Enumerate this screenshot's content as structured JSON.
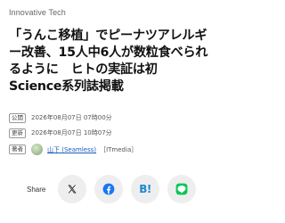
{
  "article": {
    "category": "Innovative Tech",
    "title": "「うんこ移植」でピーナツアレルギー改善、15人中6人が数粒食べられるように　ヒトの実証は初　Science系列誌掲載"
  },
  "meta": {
    "published_label": "公開",
    "published_value": "2026年08月07日 07時00分",
    "updated_label": "更新",
    "updated_value": "2026年08月07日 10時07分",
    "author_label": "著者",
    "author_name": "山下 (Seamless)",
    "author_org": "［ITmedia］"
  },
  "share": {
    "label": "Share",
    "buttons": [
      {
        "name": "x",
        "icon": "x-logo-icon"
      },
      {
        "name": "facebook",
        "icon": "facebook-icon",
        "color": "#1877f2"
      },
      {
        "name": "hatena",
        "icon": "hatena-bookmark-icon",
        "color": "#1e87ce",
        "glyph": "B!"
      },
      {
        "name": "line",
        "icon": "line-icon",
        "color": "#06c755"
      }
    ]
  }
}
